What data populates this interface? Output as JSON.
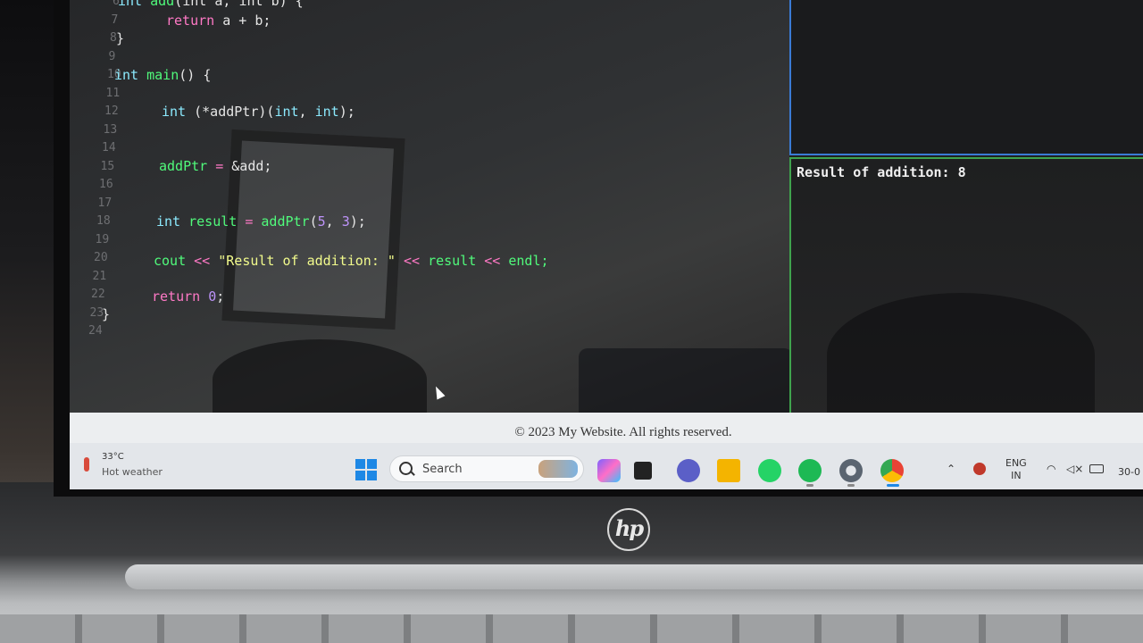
{
  "editor": {
    "lines": [
      {
        "n": "6",
        "y": 0
      },
      {
        "n": "7",
        "y": 1
      },
      {
        "n": "8",
        "y": 2
      },
      {
        "n": "9",
        "y": 3
      },
      {
        "n": "10",
        "y": 4
      },
      {
        "n": "11",
        "y": 5
      },
      {
        "n": "12",
        "y": 6
      },
      {
        "n": "13",
        "y": 7
      },
      {
        "n": "14",
        "y": 8
      },
      {
        "n": "15",
        "y": 9
      },
      {
        "n": "16",
        "y": 10
      },
      {
        "n": "17",
        "y": 11
      },
      {
        "n": "18",
        "y": 12
      },
      {
        "n": "19",
        "y": 13
      },
      {
        "n": "20",
        "y": 14
      },
      {
        "n": "21",
        "y": 15
      },
      {
        "n": "22",
        "y": 16
      },
      {
        "n": "23",
        "y": 17
      },
      {
        "n": "24",
        "y": 18
      }
    ],
    "code": {
      "l6_type": "int",
      "l6_name": "add",
      "l6_rest": "(int a, int b) {",
      "l7_kw": "return",
      "l7_rest": " a + b;",
      "l8": "}",
      "l10_type": "int",
      "l10_name": "main",
      "l10_rest": "() {",
      "l12_type": "int",
      "l12_mid": " (*addPtr)(",
      "l12_t1": "int",
      "l12_c": ", ",
      "l12_t2": "int",
      "l12_end": ");",
      "l15_var": "addPtr",
      "l15_op": " = ",
      "l15_rest": "&add;",
      "l18_type": "int",
      "l18_var": " result",
      "l18_op": " = ",
      "l18_fn": "addPtr",
      "l18_o": "(",
      "l18_n1": "5",
      "l18_c": ", ",
      "l18_n2": "3",
      "l18_end": ");",
      "l20_fn": "cout",
      "l20_op1": " << ",
      "l20_str": "\"Result of addition: \"",
      "l20_op2": " << ",
      "l20_var": "result",
      "l20_op3": " << ",
      "l20_end": "endl;",
      "l22_kw": "return",
      "l22_num": " 0",
      "l22_end": ";",
      "l23": "}"
    }
  },
  "output": {
    "text": "Result of addition: 8"
  },
  "footer": {
    "copyright": "© 2023 My Website. All rights reserved."
  },
  "taskbar": {
    "weather_temp": "33°C",
    "weather_desc": "Hot weather",
    "search_label": "Search",
    "lang_1": "ENG",
    "lang_2": "IN",
    "clock": "30-0"
  },
  "colors": {
    "keyword": "#ff79c6",
    "type": "#8be9fd",
    "function": "#50fa7b",
    "string": "#f1fa8c",
    "number": "#bd93f9",
    "output_border": "#3fa34d",
    "top_pane_border": "#3a7bd5"
  },
  "icons": [
    "windows-start-icon",
    "search-icon",
    "copilot-icon",
    "task-view-icon",
    "teams-icon",
    "file-explorer-icon",
    "whatsapp-icon",
    "spotify-icon",
    "settings-icon",
    "chrome-icon",
    "chevron-up-icon",
    "wifi-icon",
    "speaker-muted-icon",
    "battery-icon",
    "hp-logo"
  ]
}
